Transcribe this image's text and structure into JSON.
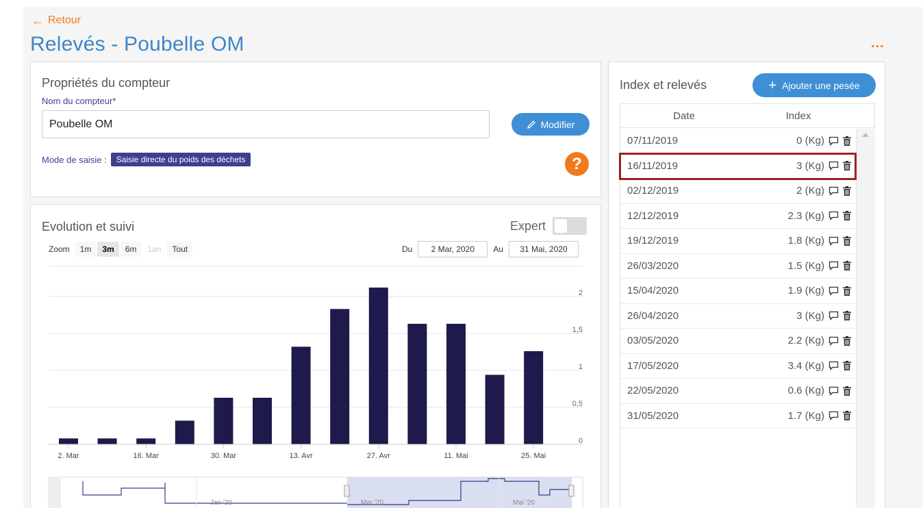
{
  "nav": {
    "back_label": "Retour",
    "more_label": "..."
  },
  "page": {
    "title": "Relevés - Poubelle OM"
  },
  "properties": {
    "title": "Propriétés du compteur",
    "name_label": "Nom du compteur*",
    "name_value": "Poubelle OM",
    "modify_label": "Modifier",
    "mode_label": "Mode de saisie :",
    "mode_value": "Saisie directe du poids des déchets",
    "help_label": "?"
  },
  "evolution": {
    "title": "Evolution et suivi",
    "expert_label": "Expert",
    "expert_enabled": false,
    "zoom_label": "Zoom",
    "zoom_options": [
      "1m",
      "3m",
      "6m",
      "1an",
      "Tout"
    ],
    "zoom_selected": "3m",
    "zoom_disabled": [
      "1an"
    ],
    "from_label": "Du",
    "from_value": "2 Mar, 2020",
    "to_label": "Au",
    "to_value": "31 Mai, 2020"
  },
  "chart_data": {
    "type": "bar",
    "bar_color": "#1e1a4b",
    "x_tick_labels": [
      "2. Mar",
      "16. Mar",
      "30. Mar",
      "13. Avr",
      "27. Avr",
      "11. Mai",
      "25. Mai"
    ],
    "y_tick_labels": [
      "0",
      "0,5",
      "1",
      "1,5",
      "2"
    ],
    "ylim": [
      0,
      2.0
    ],
    "values": [
      0.08,
      0.08,
      0.08,
      0.32,
      0.63,
      0.63,
      1.32,
      1.83,
      2.12,
      1.63,
      1.63,
      0.94,
      1.26
    ],
    "navigator_labels": [
      "Jan '20",
      "Mar '20",
      "Mai '20"
    ],
    "grid": true
  },
  "index": {
    "title": "Index et relevés",
    "add_label": "Ajouter une pesée",
    "col_date": "Date",
    "col_index": "Index",
    "highlighted_row": 1,
    "rows": [
      {
        "date": "07/11/2019",
        "value": "0 (Kg)"
      },
      {
        "date": "16/11/2019",
        "value": "3 (Kg)"
      },
      {
        "date": "02/12/2019",
        "value": "2 (Kg)"
      },
      {
        "date": "12/12/2019",
        "value": "2.3 (Kg)"
      },
      {
        "date": "19/12/2019",
        "value": "1.8 (Kg)"
      },
      {
        "date": "26/03/2020",
        "value": "1.5 (Kg)"
      },
      {
        "date": "15/04/2020",
        "value": "1.9 (Kg)"
      },
      {
        "date": "26/04/2020",
        "value": "3 (Kg)"
      },
      {
        "date": "03/05/2020",
        "value": "2.2 (Kg)"
      },
      {
        "date": "17/05/2020",
        "value": "3.4 (Kg)"
      },
      {
        "date": "22/05/2020",
        "value": "0.6 (Kg)"
      },
      {
        "date": "31/05/2020",
        "value": "1.7 (Kg)"
      }
    ]
  }
}
